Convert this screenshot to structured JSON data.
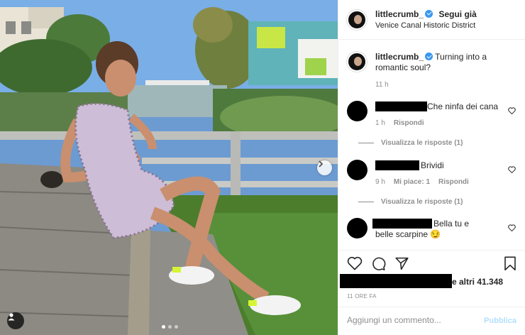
{
  "post": {
    "username": "littlecrumb_",
    "follow_label": "Segui già",
    "location": "Venice Canal Historic District",
    "more_label": "•••",
    "caption_user": "littlecrumb_",
    "caption_text": "Turning into a romantic soul?",
    "caption_time": "11 h"
  },
  "comments": [
    {
      "text": "Che ninfa dei canali",
      "time": "1 h",
      "reply_label": "Rispondi",
      "likes_label": "",
      "view_replies": "Visualizza le risposte (1)"
    },
    {
      "text": "Brividi",
      "time": "9 h",
      "likes_label": "Mi piace: 1",
      "reply_label": "Rispondi",
      "view_replies": "Visualizza le risposte (1)"
    },
    {
      "text": "Bella tu e belle scarpine 😏",
      "time": "",
      "reply_label": "",
      "likes_label": "",
      "view_replies": ""
    }
  ],
  "engagement": {
    "likes_text": "e altri 41.348",
    "posted_ago": "11 ORE FA"
  },
  "compose": {
    "placeholder": "Aggiungi un commento...",
    "publish_label": "Pubblica"
  },
  "carousel": {
    "slide_count": 3,
    "active_slide": 1
  },
  "colors": {
    "verified": "#3897f0",
    "publish_disabled": "#b2dffc",
    "meta_gray": "#8e8e8e"
  },
  "icons": [
    "heart-icon",
    "comment-icon",
    "share-icon",
    "bookmark-icon",
    "chevron-right-icon",
    "user-tag-icon",
    "verified-badge-icon"
  ]
}
